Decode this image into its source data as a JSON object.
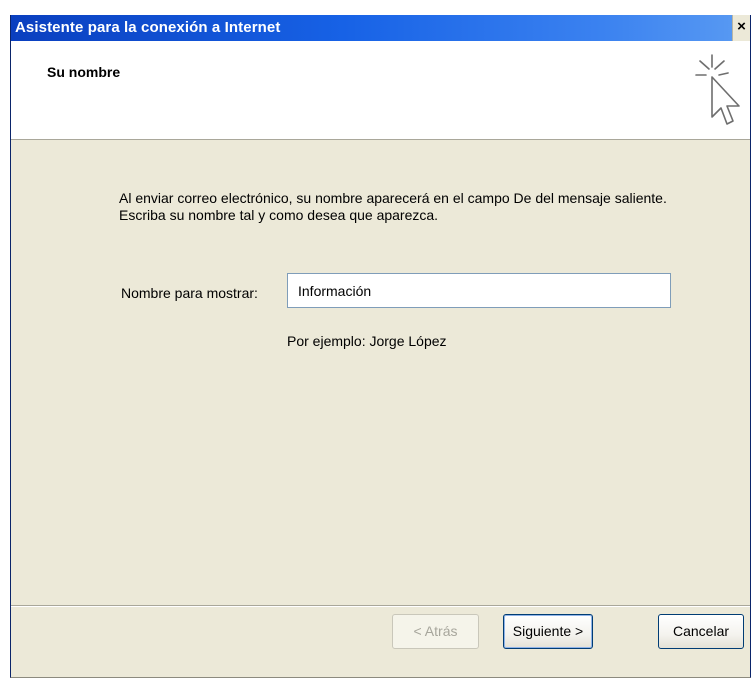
{
  "window": {
    "title": "Asistente para la conexión a Internet",
    "close_label": "×"
  },
  "header": {
    "title": "Su nombre",
    "icon": "wizard-cursor-icon"
  },
  "main": {
    "description": "Al enviar correo electrónico, su nombre aparecerá en el campo De del mensaje saliente. Escriba su nombre tal y como desea que aparezca.",
    "name_label": "Nombre para mostrar:",
    "name_value": "Información",
    "example_text": "Por ejemplo: Jorge López"
  },
  "footer": {
    "back_label": "< Atrás",
    "next_label": "Siguiente >",
    "cancel_label": "Cancelar"
  },
  "colors": {
    "titlebar": "#1762e6",
    "dialog_bg": "#ece9d8",
    "header_bg": "#ffffff"
  }
}
